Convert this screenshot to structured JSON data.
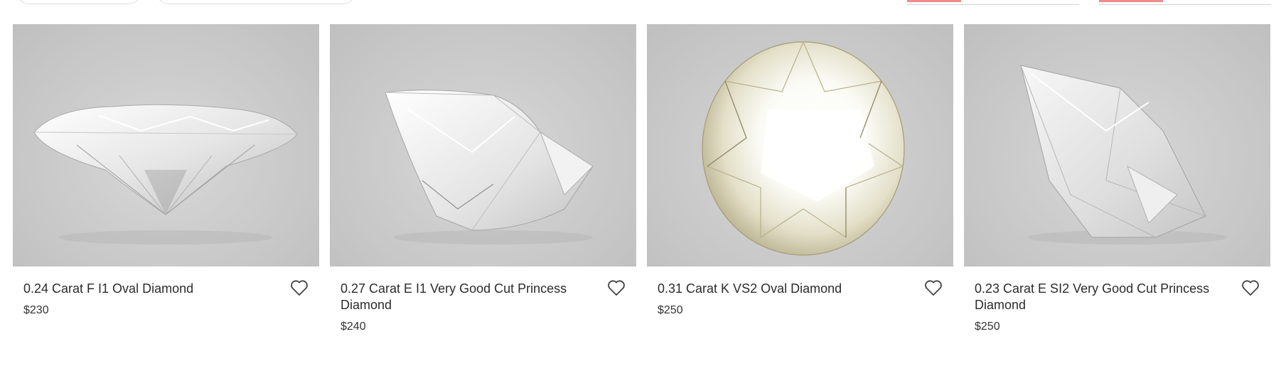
{
  "filters": {
    "pill_1": "",
    "pill_2": ""
  },
  "products": [
    {
      "title": "0.24 Carat F I1 Oval Diamond",
      "price": "$230",
      "shape": "oval",
      "favorite": false
    },
    {
      "title": "0.27 Carat E I1 Very Good Cut Princess Diamond",
      "price": "$240",
      "shape": "princess",
      "favorite": false
    },
    {
      "title": "0.31 Carat K VS2 Oval Diamond",
      "price": "$250",
      "shape": "round",
      "favorite": false
    },
    {
      "title": "0.23 Carat E SI2 Very Good Cut Princess Diamond",
      "price": "$250",
      "shape": "princess",
      "favorite": false
    }
  ],
  "icons": {
    "favorite": "heart-outline-icon"
  },
  "colors": {
    "slider_fill": "#f08b8b",
    "photo_background": "#cbcbcc"
  }
}
